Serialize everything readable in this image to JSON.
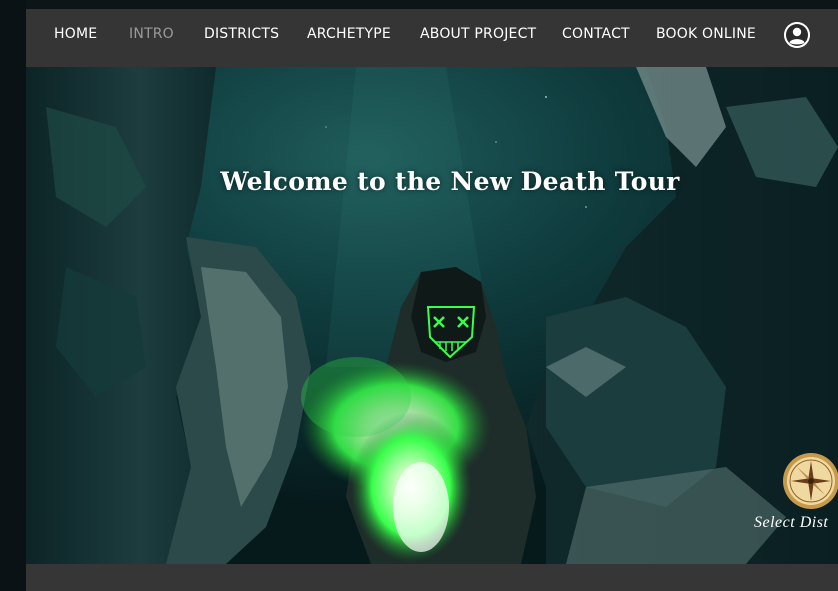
{
  "nav": {
    "items": [
      {
        "label": "HOME"
      },
      {
        "label": "INTRO"
      },
      {
        "label": "DISTRICTS"
      },
      {
        "label": "ARCHETYPE"
      },
      {
        "label": "ABOUT PROJECT"
      },
      {
        "label": "CONTACT"
      },
      {
        "label": "BOOK ONLINE"
      }
    ],
    "active": "INTRO",
    "account_icon": "user-avatar-icon"
  },
  "hero": {
    "title": "Welcome to the New Death Tour",
    "compass_icon": "compass-icon",
    "select_label": "Select Dist"
  },
  "colors": {
    "nav_background": "#353535",
    "nav_text": "#ffffff",
    "nav_active_text": "#9a9a9a",
    "page_background": "#0d1519",
    "smoke_glow": "#39ff4a"
  }
}
